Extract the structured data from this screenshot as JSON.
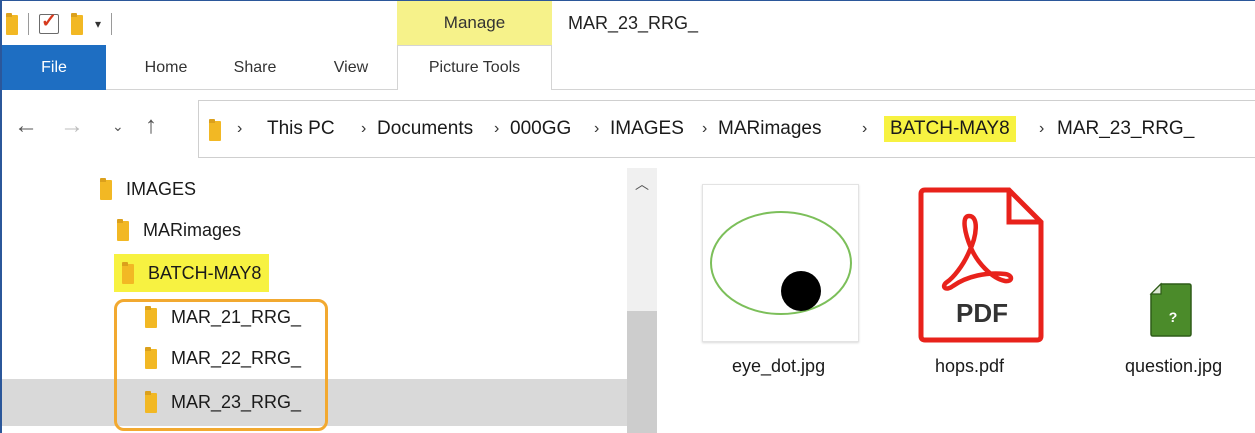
{
  "titlebar": {
    "window_title": "MAR_23_RRG_",
    "context_tab": "Manage"
  },
  "ribbon": {
    "tabs": [
      "File",
      "Home",
      "Share",
      "View",
      "Picture Tools"
    ]
  },
  "address": {
    "crumbs": [
      "This PC",
      "Documents",
      "000GG",
      "IMAGES",
      "MARimages",
      "BATCH-MAY8",
      "MAR_23_RRG_"
    ]
  },
  "tree": {
    "items": [
      "IMAGES",
      "MARimages",
      "BATCH-MAY8",
      "MAR_21_RRG_",
      "MAR_22_RRG_",
      "MAR_23_RRG_"
    ]
  },
  "files": {
    "items": [
      "eye_dot.jpg",
      "hops.pdf",
      "question.jpg"
    ],
    "pdf_text": "PDF",
    "q_text": "?"
  },
  "colors": {
    "highlight": "#f7f241",
    "manage_tab": "#f6f28a",
    "file_tab": "#1e6ec2",
    "orange_outline": "#f2a930",
    "pdf_red": "#e8221b",
    "folder": "#f2b824"
  },
  "icons": [
    "folder-icon",
    "checkmark-icon",
    "back-arrow-icon",
    "forward-arrow-icon",
    "chevron-down-icon",
    "up-arrow-icon",
    "pdf-icon",
    "image-question-icon"
  ]
}
